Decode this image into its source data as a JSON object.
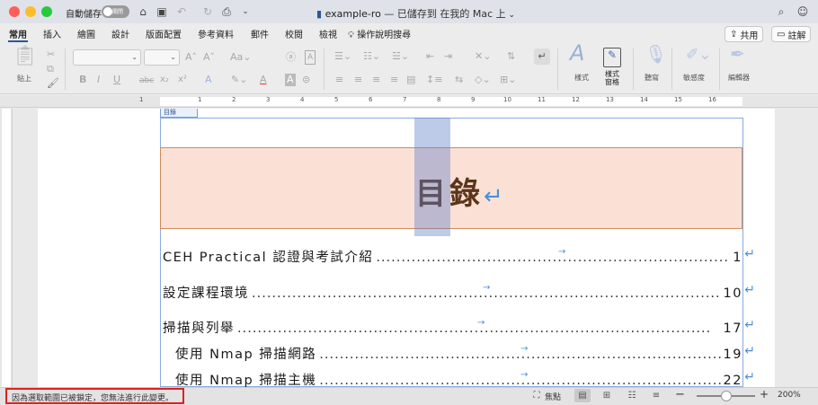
{
  "titlebar": {
    "autosave_label": "自動儲存",
    "autosave_state": "關閉",
    "doc_name": "example-ro",
    "doc_status": "— 已儲存到 在我的 Mac 上",
    "icons": [
      "home-icon",
      "save-icon",
      "undo-icon",
      "redo-icon",
      "print-icon",
      "chevron-down-icon",
      "search-icon",
      "feedback-icon"
    ]
  },
  "ribbon": {
    "tabs": [
      "常用",
      "插入",
      "繪圖",
      "設計",
      "版面配置",
      "參考資料",
      "郵件",
      "校閱",
      "檢視"
    ],
    "tell_me": "操作說明搜尋",
    "share_label": "共用",
    "comment_label": "註解",
    "paste_label": "貼上",
    "styles_label": "樣式",
    "styles_pane_label": "樣式\n窗格",
    "dictate_label": "聽寫",
    "sensitivity_label": "敏感度",
    "editor_label": "編輯器",
    "font_buttons": [
      "B",
      "I",
      "U",
      "abc",
      "x₂",
      "x²",
      "A",
      "A",
      "A"
    ]
  },
  "ruler": {
    "numbers": [
      "1",
      "1",
      "2",
      "3",
      "4",
      "5",
      "6",
      "7",
      "8",
      "9",
      "10",
      "11",
      "12",
      "13",
      "14",
      "15",
      "16"
    ]
  },
  "document": {
    "content_control_tag": "目錄",
    "heading": "目錄",
    "toc": [
      {
        "text": "CEH Practical 認證與考試介紹",
        "page": "1",
        "indent": false
      },
      {
        "text": "設定課程環境",
        "page": "10",
        "indent": false
      },
      {
        "text": "掃描與列舉",
        "page": "17",
        "indent": false
      },
      {
        "text": "使用 Nmap 掃描網路",
        "page": "19",
        "indent": true
      },
      {
        "text": "使用 Nmap 掃描主機",
        "page": "22",
        "indent": true
      }
    ],
    "return_mark": "↵"
  },
  "statusbar": {
    "message": "因為選取範圍已被鎖定，您無法進行此變更。",
    "focus_label": "焦點",
    "zoom": "200%",
    "zoom_level": 0.5
  },
  "colors": {
    "heading_fill": "#fbe1d5",
    "heading_border": "#d08a5a",
    "heading_text": "#5b3519",
    "selection": "#6280c8",
    "accent": "#2b579a",
    "alert": "#e0201e"
  }
}
